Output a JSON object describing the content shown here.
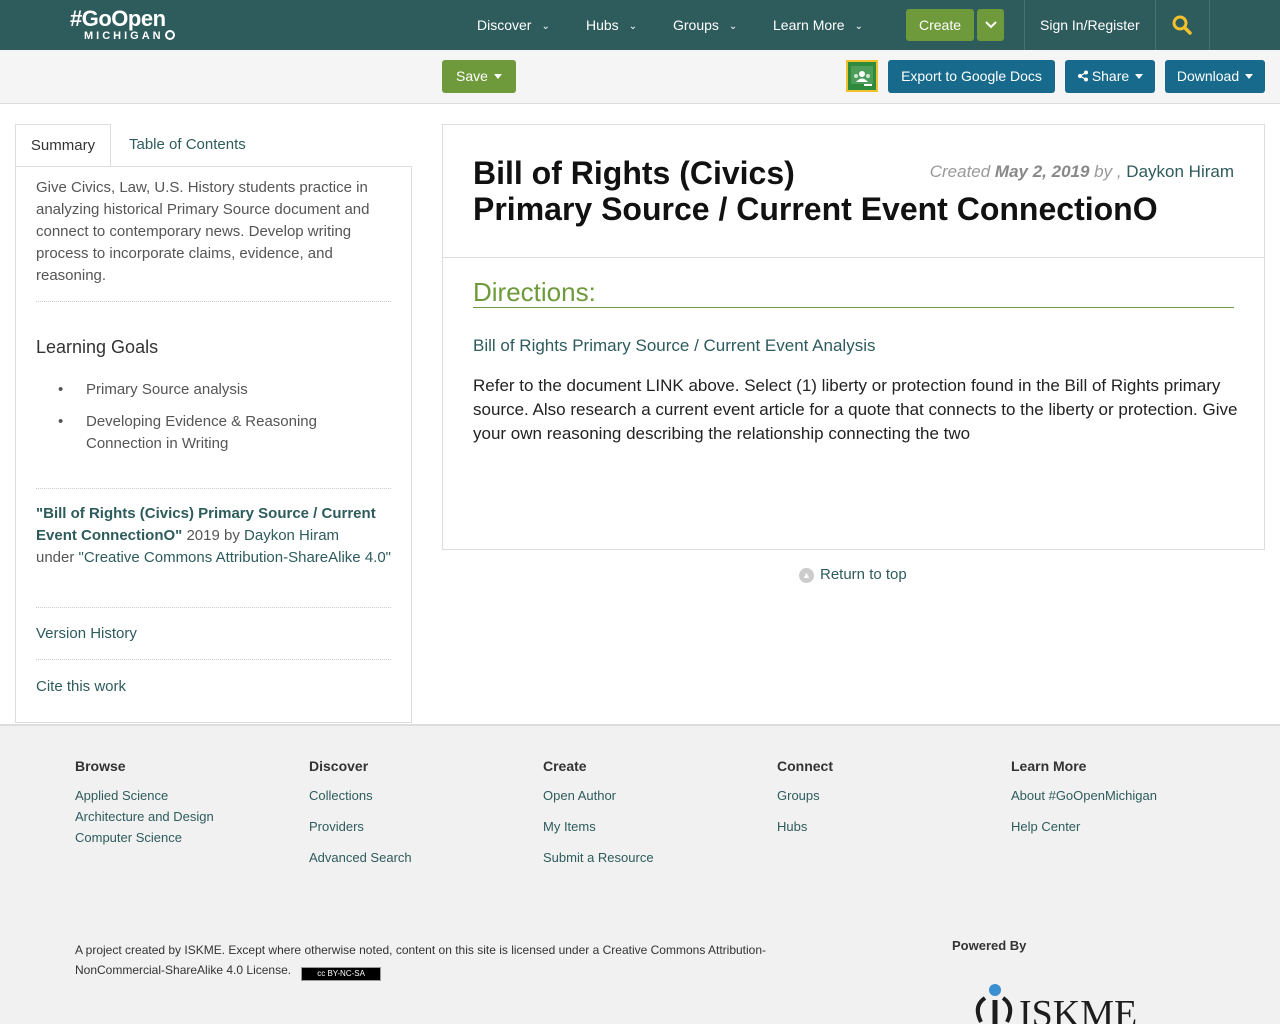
{
  "nav": {
    "logo_line1": "#GoOpen",
    "logo_line2": "MICHIGAN",
    "items": [
      "Discover",
      "Hubs",
      "Groups",
      "Learn More"
    ],
    "create": "Create",
    "signin": "Sign In/Register"
  },
  "toolbar": {
    "save": "Save",
    "export": "Export to Google Docs",
    "share": "Share",
    "download": "Download"
  },
  "sidebar": {
    "tabs": [
      "Summary",
      "Table of Contents"
    ],
    "summary": "Give Civics, Law, U.S. History students practice in analyzing historical Primary Source document and connect to contemporary news. Develop writing process to incorporate claims, evidence, and reasoning.",
    "learning_goals_title": "Learning Goals",
    "learning_goals": [
      "Primary Source analysis",
      "Developing Evidence & Reasoning Connection in Writing"
    ],
    "attribution": {
      "title": "\"Bill of Rights (Civics) Primary Source / Current Event ConnectionO\"",
      "year_by": " 2019 by ",
      "author": "Daykon Hiram",
      "under": "under ",
      "license": "\"Creative Commons Attribution-ShareAlike 4.0\""
    },
    "version_history": "Version History",
    "cite": "Cite this work"
  },
  "main": {
    "title_line1": "Bill of Rights (Civics)",
    "title_line2": "Primary Source / Current Event ConnectionO",
    "created_label": "Created ",
    "created_date": "May 2, 2019",
    "by": " by , ",
    "author": "Daykon Hiram",
    "directions": "Directions:",
    "analysis_title": "Bill of Rights Primary Source / Current Event Analysis",
    "body": "Refer to the document LINK above. Select (1) liberty or protection found in the Bill of Rights primary source. Also research a current event article for a quote that connects to the liberty or protection. Give your own reasoning describing the relationship connecting the two",
    "return_top": "Return to top"
  },
  "footer": {
    "columns": [
      {
        "title": "Browse",
        "links": [
          "Applied Science",
          "Architecture and Design",
          "Computer Science"
        ]
      },
      {
        "title": "Discover",
        "links": [
          "Collections",
          "Providers",
          "Advanced Search"
        ]
      },
      {
        "title": "Create",
        "links": [
          "Open Author",
          "My Items",
          "Submit a Resource"
        ]
      },
      {
        "title": "Connect",
        "links": [
          "Groups",
          "Hubs"
        ]
      },
      {
        "title": "Learn More",
        "links": [
          "About #GoOpenMichigan",
          "Help Center"
        ]
      }
    ],
    "license": "A project created by ISKME. Except where otherwise noted, content on this site is licensed under a Creative Commons Attribution-NonCommercial-ShareAlike 4.0 License.",
    "cc_badge": "cc BY-NC-SA",
    "powered_by": "Powered By",
    "iskme": "ISKME"
  },
  "colors": {
    "nav_bg": "#2e5b5c",
    "green": "#6f9a3b",
    "blue_btn": "#176a8c",
    "link": "#2e5b5c"
  }
}
